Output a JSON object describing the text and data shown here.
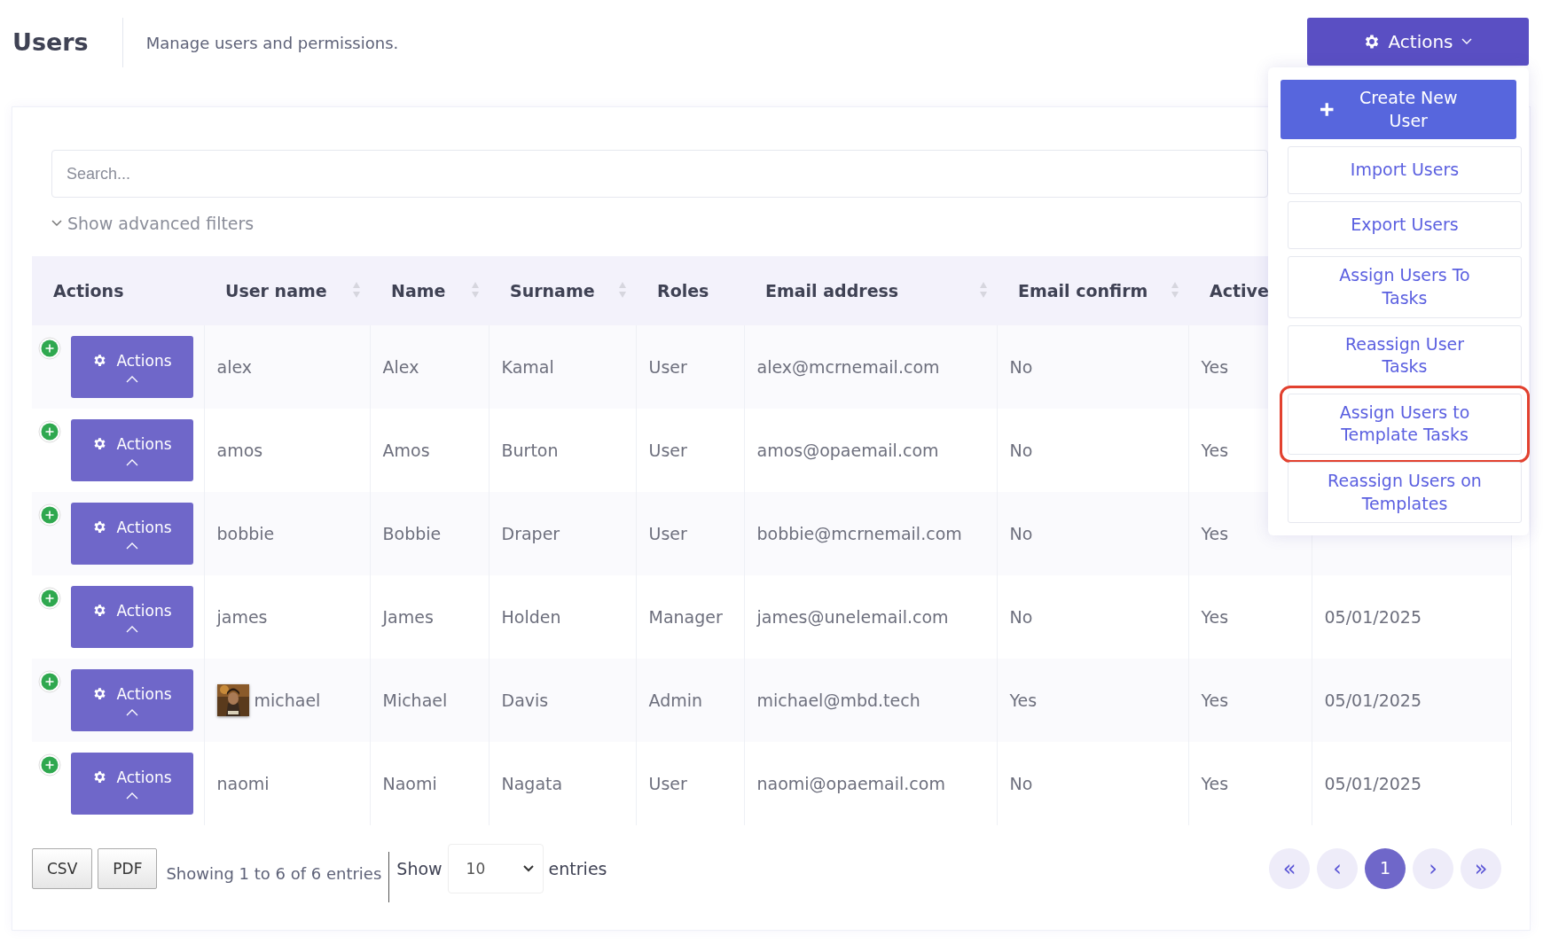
{
  "header": {
    "title": "Users",
    "subtitle": "Manage users and permissions.",
    "actions_button": {
      "label": "Actions",
      "expanded": true
    }
  },
  "actions_menu": [
    {
      "kind": "primary",
      "label": "Create New User",
      "highlighted": false
    },
    {
      "kind": "outline",
      "label": "Import Users",
      "highlighted": false
    },
    {
      "kind": "outline",
      "label": "Export Users",
      "highlighted": false
    },
    {
      "kind": "outline",
      "label": "Assign Users To Tasks",
      "highlighted": false
    },
    {
      "kind": "outline",
      "label": "Reassign User Tasks",
      "highlighted": false
    },
    {
      "kind": "outline",
      "label": "Assign Users to Template Tasks",
      "highlighted": true
    },
    {
      "kind": "outline",
      "label": "Reassign Users on Templates",
      "highlighted": false
    }
  ],
  "search": {
    "placeholder": "Search..."
  },
  "advanced_filters": {
    "label": "Show advanced filters",
    "expanded": false
  },
  "table": {
    "columns": [
      {
        "label": "Actions",
        "sortable": false
      },
      {
        "label": "User name",
        "sortable": true
      },
      {
        "label": "Name",
        "sortable": true
      },
      {
        "label": "Surname",
        "sortable": true
      },
      {
        "label": "Roles",
        "sortable": false
      },
      {
        "label": "Email address",
        "sortable": true
      },
      {
        "label": "Email confirm",
        "sortable": true
      },
      {
        "label": "Active",
        "sortable": false
      }
    ],
    "rows": [
      {
        "action_label": "Actions",
        "username": "alex",
        "name": "Alex",
        "surname": "Kamal",
        "roles": "User",
        "email": "alex@mcrnemail.com",
        "email_confirm": "No",
        "active": "Yes"
      },
      {
        "action_label": "Actions",
        "username": "amos",
        "name": "Amos",
        "surname": "Burton",
        "roles": "User",
        "email": "amos@opaemail.com",
        "email_confirm": "No",
        "active": "Yes"
      },
      {
        "action_label": "Actions",
        "username": "bobbie",
        "name": "Bobbie",
        "surname": "Draper",
        "roles": "User",
        "email": "bobbie@mcrnemail.com",
        "email_confirm": "No",
        "active": "Yes"
      },
      {
        "action_label": "Actions",
        "username": "james",
        "name": "James",
        "surname": "Holden",
        "roles": "Manager",
        "email": "james@unelemail.com",
        "email_confirm": "No",
        "active": "Yes",
        "column_9": "05/01/2025"
      },
      {
        "action_label": "Actions",
        "username": "michael",
        "name": "Michael",
        "surname": "Davis",
        "roles": "Admin",
        "email": "michael@mbd.tech",
        "email_confirm": "Yes",
        "active": "Yes",
        "column_9": "05/01/2025"
      },
      {
        "action_label": "Actions",
        "username": "naomi",
        "name": "Naomi",
        "surname": "Nagata",
        "roles": "User",
        "email": "naomi@opaemail.com",
        "email_confirm": "No",
        "active": "Yes",
        "column_9": "05/01/2025"
      }
    ]
  },
  "footer": {
    "export_buttons": [
      "CSV",
      "PDF"
    ],
    "info": "Showing 1 to 6 of 6 entries",
    "show_label": "Show",
    "page_size": "10",
    "entries_label": "entries",
    "pagination": [
      {
        "label": "«",
        "selected": false
      },
      {
        "label": "‹",
        "selected": false
      },
      {
        "label": "1",
        "selected": true
      },
      {
        "label": "›",
        "selected": false
      },
      {
        "label": "»",
        "selected": false
      }
    ]
  }
}
